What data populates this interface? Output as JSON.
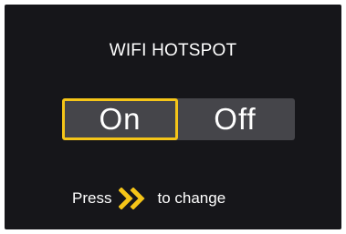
{
  "screen": {
    "title": "WIFI HOTSPOT",
    "toggle": {
      "options": [
        {
          "label": "On",
          "selected": true
        },
        {
          "label": "Off",
          "selected": false
        }
      ]
    },
    "hint": {
      "prefix": "Press",
      "icon": "double-chevron-right-icon",
      "suffix": "to change"
    },
    "colors": {
      "background": "#16161a",
      "accent": "#f5c518",
      "option_bg": "#45454a",
      "text": "#ffffff"
    }
  }
}
